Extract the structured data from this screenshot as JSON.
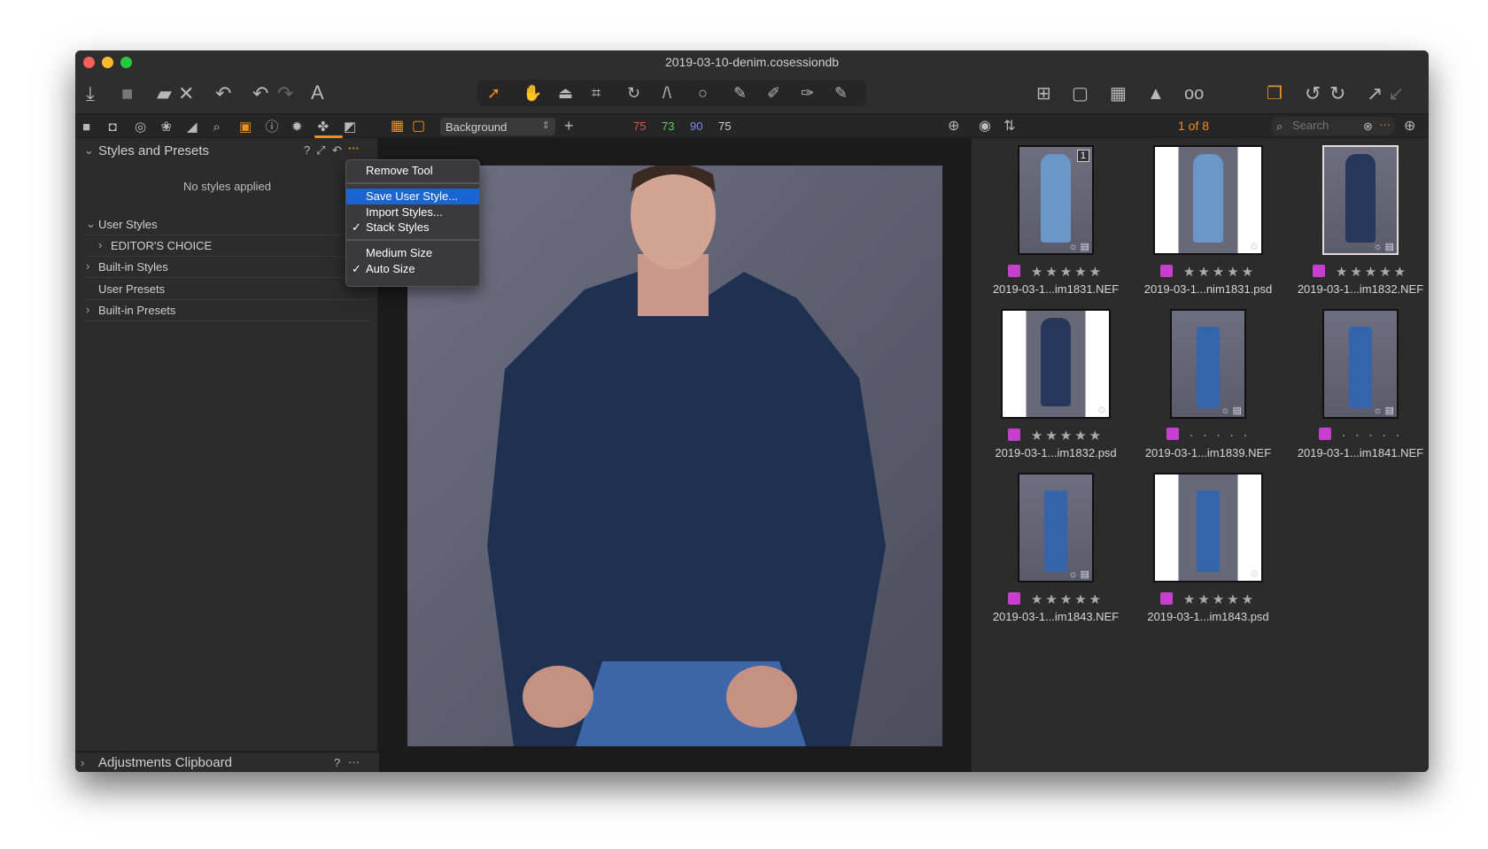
{
  "window": {
    "title": "2019-03-10-denim.cosessiondb"
  },
  "colors": {
    "accent": "#f0901e",
    "tag": "#c83fcf",
    "menu_highlight": "#1a64d4"
  },
  "toolbar": {
    "left_icons": [
      "import-icon",
      "camera-icon",
      "export-icon",
      "delete-icon",
      "undo-all-icon",
      "undo-icon",
      "redo-icon",
      "text-overlay-icon"
    ],
    "cursor_tools": [
      "select-cursor-icon",
      "pan-icon",
      "loupe-icon",
      "crop-icon",
      "rotate-icon",
      "keystone-icon",
      "spot-removal-icon",
      "brush-icon",
      "erase-icon",
      "gradient-icon",
      "pick-mask-icon"
    ],
    "right_icons": [
      "overlay-icon",
      "annotate-icon",
      "grid-icon",
      "exposure-warning-icon",
      "proof-icon",
      "variants-icon",
      "rotate-left-icon",
      "rotate-right-icon",
      "next-icon",
      "previous-icon"
    ]
  },
  "tool_tabs": [
    "library-icon",
    "capture-icon",
    "lens-icon",
    "color-icon",
    "exposure-icon",
    "details-icon",
    "adjustments-icon",
    "metadata-icon",
    "output-icon",
    "batch-icon",
    "styles-icon"
  ],
  "layers": {
    "name": "Background",
    "r": "75",
    "g": "73",
    "b": "90",
    "l": "75"
  },
  "browser_bar": {
    "count": "1 of 8",
    "search_placeholder": "Search"
  },
  "styles_panel": {
    "title": "Styles and Presets",
    "empty": "No styles applied",
    "items": [
      {
        "label": "User Styles",
        "indent": 0,
        "expanded": true
      },
      {
        "label": "EDITOR'S CHOICE",
        "indent": 1,
        "expanded": false
      },
      {
        "label": "Built-in Styles",
        "indent": 0,
        "expanded": false
      },
      {
        "label": "User Presets",
        "indent": 0,
        "leaf": true
      },
      {
        "label": "Built-in Presets",
        "indent": 0,
        "expanded": false
      }
    ]
  },
  "context_menu": {
    "items": [
      {
        "label": "Remove Tool"
      },
      {
        "label": "Save User Style...",
        "highlighted": true
      },
      {
        "label": "Import Styles..."
      },
      {
        "label": "Stack Styles",
        "checked": true
      },
      {
        "label": "Medium Size"
      },
      {
        "label": "Auto Size",
        "checked": true
      }
    ]
  },
  "clipboard_panel": {
    "title": "Adjustments Clipboard",
    "help": "?",
    "more": "···"
  },
  "help": "?",
  "more": "···",
  "thumbnails": [
    {
      "name": "2019-03-1...im1831.NEF",
      "rating": 5,
      "subject": "shirt",
      "white": false,
      "badge": "1"
    },
    {
      "name": "2019-03-1...nim1831.psd",
      "rating": 5,
      "subject": "shirt",
      "white": true
    },
    {
      "name": "2019-03-1...im1832.NEF",
      "rating": 5,
      "subject": "jacket",
      "white": false,
      "selected": true
    },
    {
      "name": "2019-03-1...im1832.psd",
      "rating": 5,
      "subject": "jacket",
      "white": true
    },
    {
      "name": "2019-03-1...im1839.NEF",
      "rating": 0,
      "subject": "jeans",
      "white": false
    },
    {
      "name": "2019-03-1...im1841.NEF",
      "rating": 0,
      "subject": "jeans",
      "white": false
    },
    {
      "name": "2019-03-1...im1843.NEF",
      "rating": 5,
      "subject": "jeans",
      "white": false
    },
    {
      "name": "2019-03-1...im1843.psd",
      "rating": 5,
      "subject": "jeans",
      "white": true
    }
  ]
}
